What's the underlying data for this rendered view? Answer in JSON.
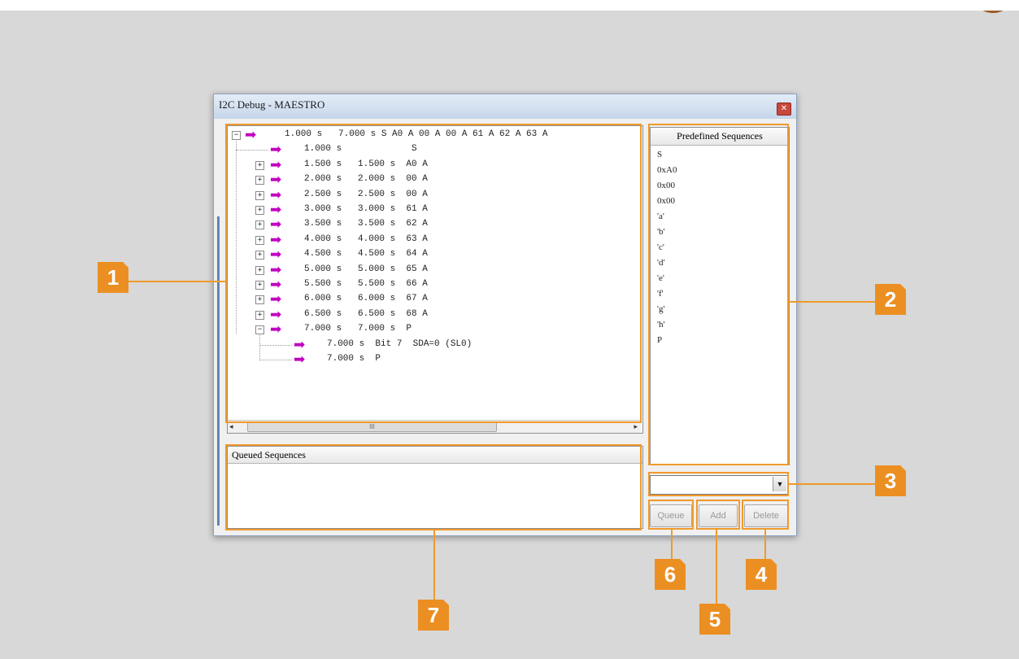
{
  "window": {
    "title": "I2C Debug - MAESTRO",
    "close_icon": "close-icon"
  },
  "tree": {
    "rows": [
      {
        "text": "1.000 s   7.000 s S A0 A 00 A 00 A 61 A 62 A 63 A",
        "expander": "−"
      },
      {
        "text": "1.000 s             S",
        "expander": ""
      },
      {
        "text": "1.500 s   1.500 s  A0 A",
        "expander": "+"
      },
      {
        "text": "2.000 s   2.000 s  00 A",
        "expander": "+"
      },
      {
        "text": "2.500 s   2.500 s  00 A",
        "expander": "+"
      },
      {
        "text": "3.000 s   3.000 s  61 A",
        "expander": "+"
      },
      {
        "text": "3.500 s   3.500 s  62 A",
        "expander": "+"
      },
      {
        "text": "4.000 s   4.000 s  63 A",
        "expander": "+"
      },
      {
        "text": "4.500 s   4.500 s  64 A",
        "expander": "+"
      },
      {
        "text": "5.000 s   5.000 s  65 A",
        "expander": "+"
      },
      {
        "text": "5.500 s   5.500 s  66 A",
        "expander": "+"
      },
      {
        "text": "6.000 s   6.000 s  67 A",
        "expander": "+"
      },
      {
        "text": "6.500 s   6.500 s  68 A",
        "expander": "+"
      },
      {
        "text": "7.000 s   7.000 s  P",
        "expander": "−"
      },
      {
        "text": "7.000 s  Bit 7  SDA=0 (SL0)",
        "expander": ""
      },
      {
        "text": "7.000 s  P",
        "expander": ""
      }
    ],
    "arrow_glyph": "➡",
    "scroll_thumb_label": "III"
  },
  "queued": {
    "header": "Queued Sequences"
  },
  "predefined": {
    "header": "Predefined Sequences",
    "items": [
      "S",
      "0xA0",
      "0x00",
      "0x00",
      "'a'",
      "'b'",
      "'c'",
      "'d'",
      "'e'",
      "'f'",
      "'g'",
      "'h'",
      "P"
    ]
  },
  "combo": {
    "value": ""
  },
  "buttons": {
    "queue": "Queue",
    "add": "Add",
    "delete": "Delete"
  },
  "callouts": [
    "1",
    "2",
    "3",
    "4",
    "5",
    "6",
    "7"
  ],
  "colors": {
    "callout": "#ec8f22",
    "arrow": "#c000c0",
    "brand": "#9b5a24"
  }
}
